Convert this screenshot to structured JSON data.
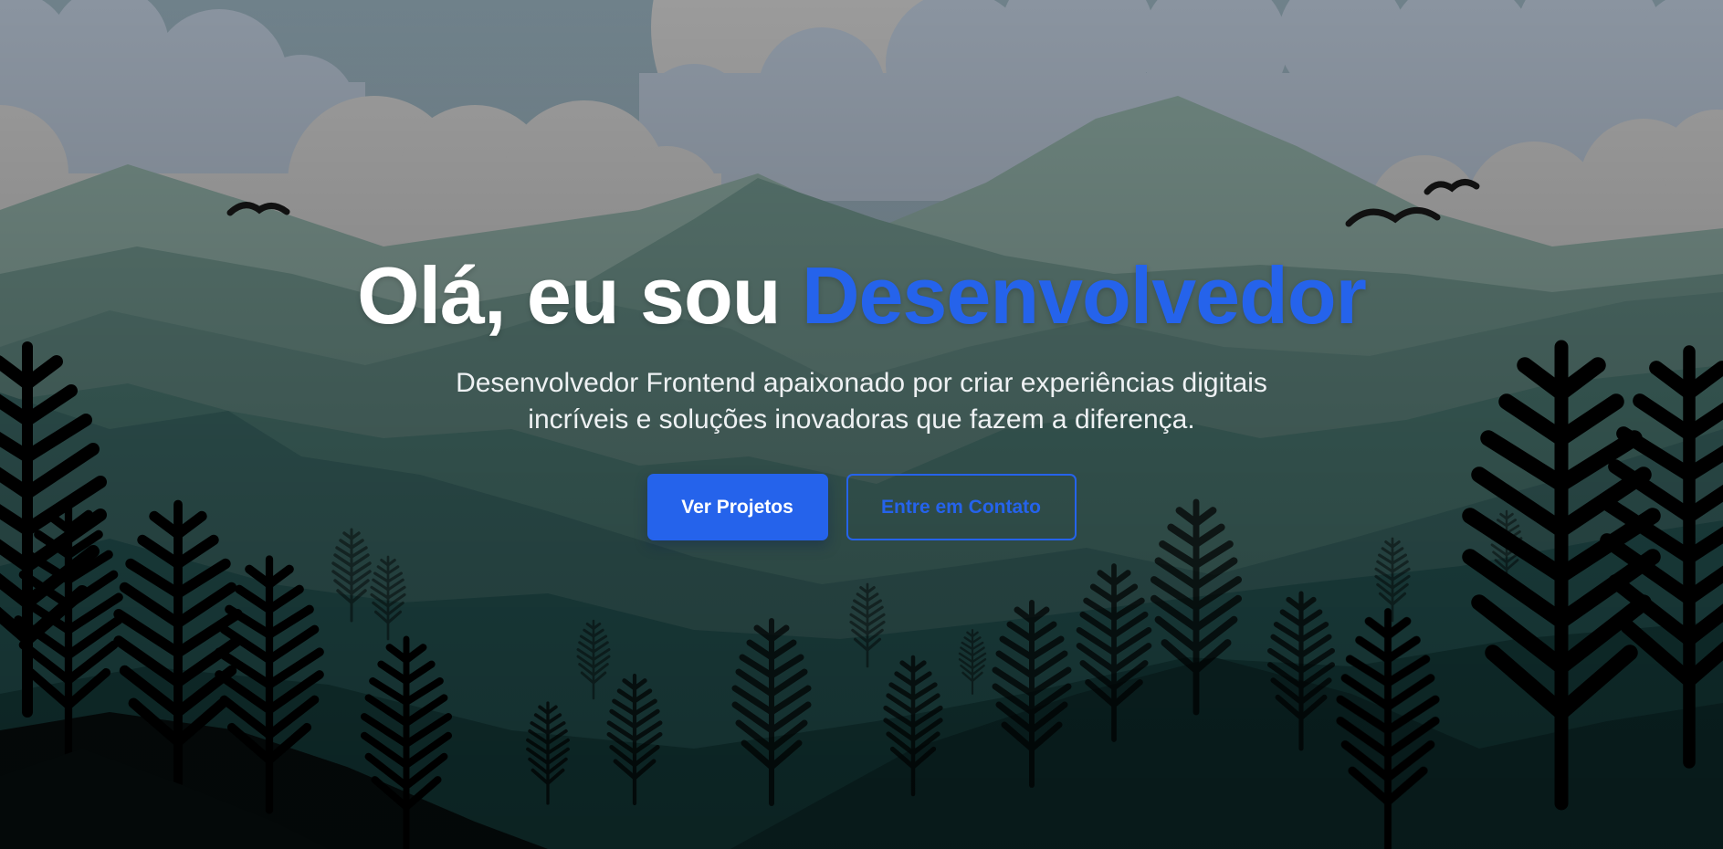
{
  "hero": {
    "title_prefix": "Olá, eu sou",
    "title_highlight": "Desenvolvedor",
    "subtitle_line1": "Desenvolvedor Frontend apaixonado por criar experiências digitais",
    "subtitle_line2": "incríveis e soluções inovadoras que fazem a diferença.",
    "primary_button": "Ver Projetos",
    "secondary_button": "Entre em Contato"
  },
  "colors": {
    "accent": "#2563eb",
    "text": "#ffffff",
    "sky": "#7f8c96",
    "foreground": "#061312"
  },
  "icons": [
    "bird-icon",
    "pine-tree-icon",
    "mountain-icon",
    "cloud-icon",
    "moon-icon"
  ]
}
